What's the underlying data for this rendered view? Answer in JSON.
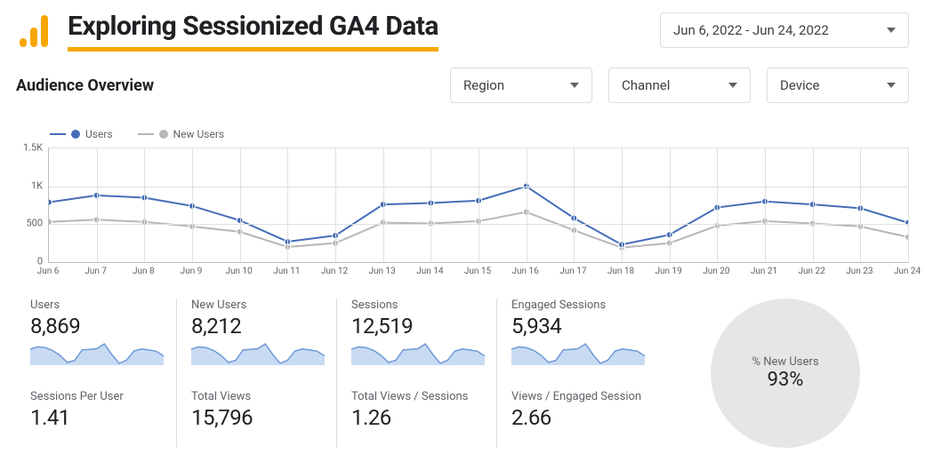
{
  "header": {
    "title": "Exploring Sessionized GA4 Data",
    "date_range": "Jun 6, 2022 - Jun 24, 2022"
  },
  "subtitle": "Audience Overview",
  "filters": [
    {
      "label": "Region"
    },
    {
      "label": "Channel"
    },
    {
      "label": "Device"
    }
  ],
  "legend": {
    "users": "Users",
    "new_users": "New Users"
  },
  "colors": {
    "users": "#456db8",
    "new_users": "#b7b7b7",
    "spark_fill": "#c9dbf3",
    "spark_stroke": "#6b9ad6"
  },
  "chart_data": {
    "type": "line",
    "xlabel": "",
    "ylabel": "",
    "ylim": [
      0,
      1500
    ],
    "yticks": [
      0,
      500,
      1000,
      1500
    ],
    "ytick_labels": [
      "0",
      "500",
      "1K",
      "1.5K"
    ],
    "categories": [
      "Jun 6",
      "Jun 7",
      "Jun 8",
      "Jun 9",
      "Jun 10",
      "Jun 11",
      "Jun 12",
      "Jun 13",
      "Jun 14",
      "Jun 15",
      "Jun 16",
      "Jun 17",
      "Jun 18",
      "Jun 19",
      "Jun 20",
      "Jun 21",
      "Jun 22",
      "Jun 23",
      "Jun 24"
    ],
    "series": [
      {
        "name": "Users",
        "values": [
          790,
          880,
          850,
          740,
          550,
          270,
          350,
          760,
          780,
          810,
          1000,
          580,
          230,
          360,
          720,
          800,
          760,
          710,
          520
        ]
      },
      {
        "name": "New Users",
        "values": [
          530,
          560,
          530,
          470,
          400,
          200,
          250,
          520,
          510,
          540,
          660,
          420,
          190,
          250,
          480,
          540,
          510,
          470,
          330
        ]
      }
    ]
  },
  "metrics": [
    {
      "label": "Users",
      "value": "8,869",
      "spark": true
    },
    {
      "label": "New Users",
      "value": "8,212",
      "spark": true
    },
    {
      "label": "Sessions",
      "value": "12,519",
      "spark": true
    },
    {
      "label": "Engaged Sessions",
      "value": "5,934",
      "spark": true
    },
    {
      "label": "Sessions Per User",
      "value": "1.41",
      "spark": false
    },
    {
      "label": "Total Views",
      "value": "15,796",
      "spark": false
    },
    {
      "label": "Total Views / Sessions",
      "value": "1.26",
      "spark": false
    },
    {
      "label": "Views / Engaged Session",
      "value": "2.66",
      "spark": false
    }
  ],
  "gauge": {
    "label": "% New Users",
    "value": "93%"
  }
}
